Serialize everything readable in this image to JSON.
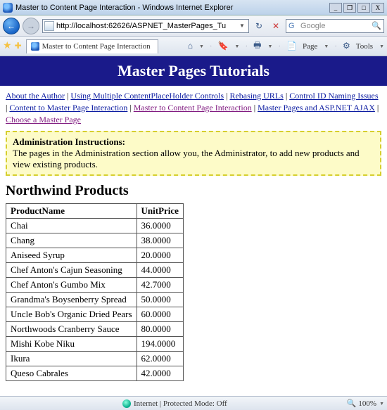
{
  "window": {
    "title": "Master to Content Page Interaction - Windows Internet Explorer",
    "minimize": "_",
    "restore": "❐",
    "maximize": "□",
    "close": "X"
  },
  "nav": {
    "back": "←",
    "forward": "→",
    "url": "http://localhost:62626/ASPNET_MasterPages_Tu",
    "url_drop": "▼",
    "refresh": "↻",
    "stop": "✕",
    "search_placeholder": "Google",
    "search_go": "🔍"
  },
  "cmdbar": {
    "tab_title": "Master to Content Page Interaction",
    "home": "⌂",
    "feeds": "🔖",
    "print": "🖶",
    "page_label": "Page",
    "tools_label": "Tools"
  },
  "banner": {
    "title": "Master Pages Tutorials"
  },
  "links": {
    "items": [
      {
        "text": "About the Author",
        "visited": false
      },
      {
        "text": "Using Multiple ContentPlaceHolder Controls",
        "visited": false
      },
      {
        "text": "Rebasing URLs",
        "visited": false
      },
      {
        "text": "Control ID Naming Issues",
        "visited": false
      },
      {
        "text": "Content to Master Page Interaction",
        "visited": false
      },
      {
        "text": "Master to Content Page Interaction",
        "visited": true
      },
      {
        "text": "Master Pages and ASP.NET AJAX",
        "visited": false
      },
      {
        "text": "Choose a Master Page",
        "visited": true
      }
    ],
    "sep": " | "
  },
  "admin": {
    "title": "Administration Instructions:",
    "body": "The pages in the Administration section allow you, the Administrator, to add new products and view existing products."
  },
  "section": {
    "title": "Northwind Products"
  },
  "table": {
    "columns": [
      "ProductName",
      "UnitPrice"
    ],
    "rows": [
      {
        "name": "Chai",
        "price": "36.0000"
      },
      {
        "name": "Chang",
        "price": "38.0000"
      },
      {
        "name": "Aniseed Syrup",
        "price": "20.0000"
      },
      {
        "name": "Chef Anton's Cajun Seasoning",
        "price": "44.0000"
      },
      {
        "name": "Chef Anton's Gumbo Mix",
        "price": "42.7000"
      },
      {
        "name": "Grandma's Boysenberry Spread",
        "price": "50.0000"
      },
      {
        "name": "Uncle Bob's Organic Dried Pears",
        "price": "60.0000"
      },
      {
        "name": "Northwoods Cranberry Sauce",
        "price": "80.0000"
      },
      {
        "name": "Mishi Kobe Niku",
        "price": "194.0000"
      },
      {
        "name": "Ikura",
        "price": "62.0000"
      },
      {
        "name": "Queso Cabrales",
        "price": "42.0000"
      }
    ]
  },
  "status": {
    "done": "",
    "zone": "Internet | Protected Mode: Off",
    "zoom": "100%"
  }
}
